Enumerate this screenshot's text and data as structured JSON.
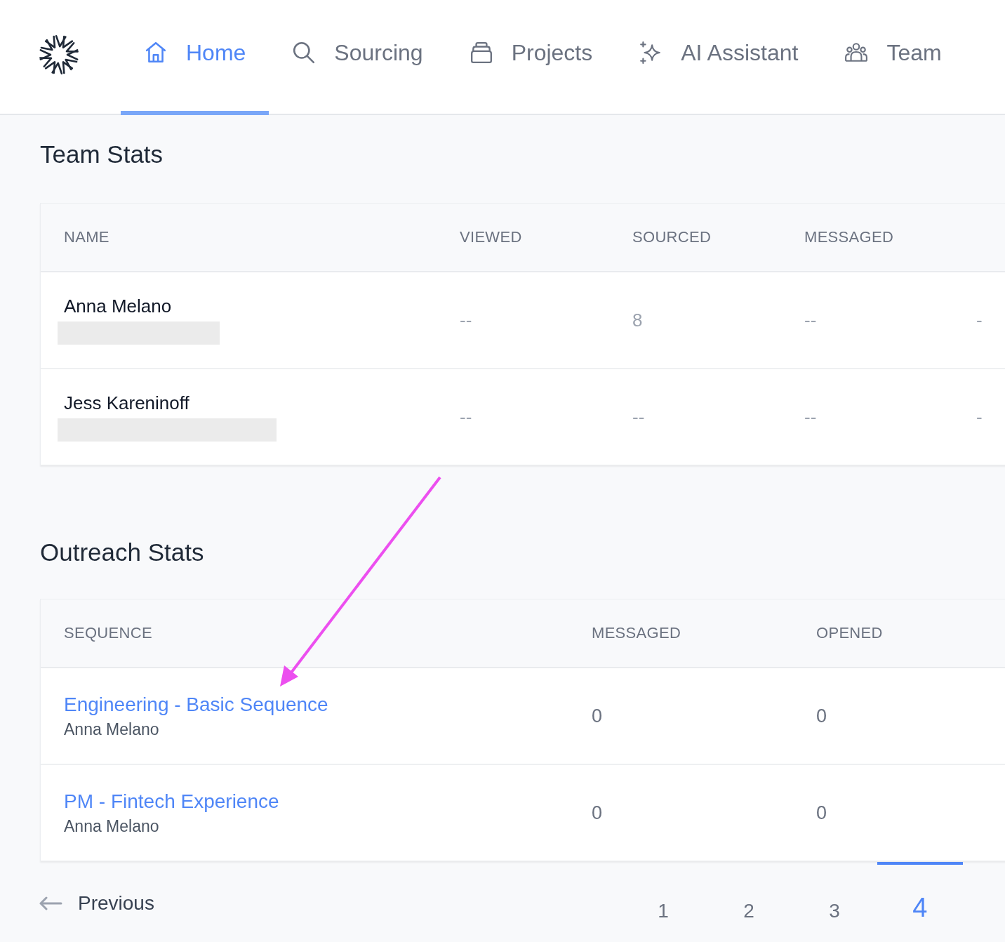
{
  "nav": {
    "tabs": [
      {
        "label": "Home",
        "kind": "home",
        "selected": true
      },
      {
        "label": "Sourcing",
        "kind": "search",
        "selected": false
      },
      {
        "label": "Projects",
        "kind": "stack",
        "selected": false
      },
      {
        "label": "AI Assistant",
        "kind": "sparkle",
        "selected": false
      },
      {
        "label": "Team",
        "kind": "people",
        "selected": false
      }
    ]
  },
  "team_stats": {
    "title": "Team Stats",
    "columns": [
      "NAME",
      "VIEWED",
      "SOURCED",
      "MESSAGED"
    ],
    "rows": [
      {
        "name": "Anna Melano",
        "viewed": "--",
        "sourced": "8",
        "messaged": "--",
        "column_5": "-"
      },
      {
        "name": "Jess Kareninoff",
        "viewed": "--",
        "sourced": "--",
        "messaged": "--",
        "column_5": "-"
      }
    ]
  },
  "outreach_stats": {
    "title": "Outreach Stats",
    "columns": [
      "SEQUENCE",
      "MESSAGED",
      "OPENED"
    ],
    "rows": [
      {
        "sequence": "Engineering - Basic Sequence",
        "owner": "Anna Melano",
        "messaged": "0",
        "opened": "0"
      },
      {
        "sequence": "PM - Fintech Experience",
        "owner": "Anna Melano",
        "messaged": "0",
        "opened": "0"
      }
    ]
  },
  "pagination": {
    "previous": "Previous",
    "pages": [
      {
        "label": "1",
        "selected": false
      },
      {
        "label": "2",
        "selected": false
      },
      {
        "label": "3",
        "selected": false
      },
      {
        "label": "4",
        "selected": true
      }
    ]
  }
}
